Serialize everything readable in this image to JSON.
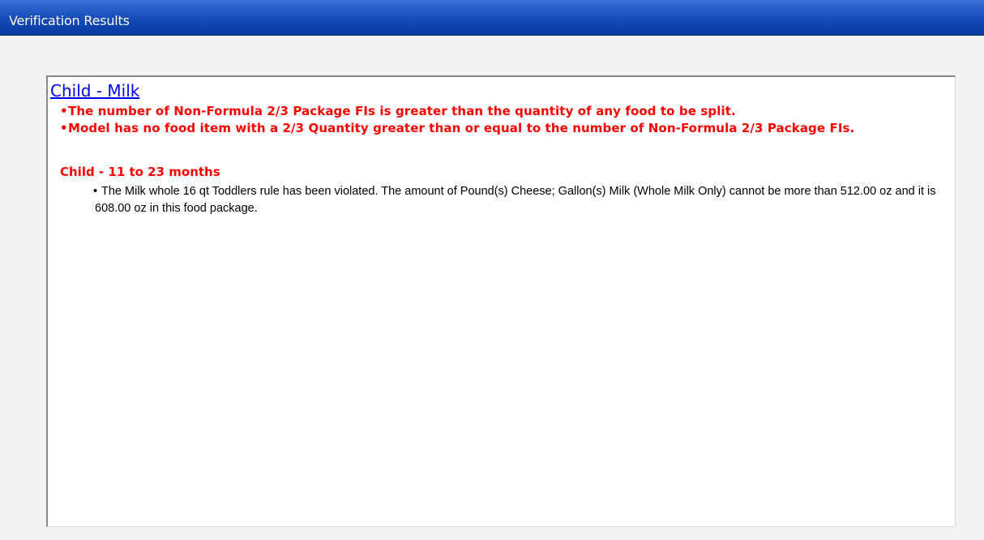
{
  "window": {
    "title": "Verification Results"
  },
  "results": {
    "group_title": "Child - Milk",
    "errors": [
      "The number of Non-Formula 2/3 Package FIs is greater than the quantity of any food to be split.",
      "Model has no food item with a 2/3 Quantity greater than or equal to the number of Non-Formula 2/3 Package FIs."
    ],
    "subgroup": {
      "title": "Child - 11 to 23 months",
      "violations": [
        "The Milk whole 16 qt Toddlers rule has been violated. The amount of Pound(s) Cheese; Gallon(s) Milk (Whole Milk Only) cannot be more than 512.00 oz and it is 608.00 oz in this food package."
      ]
    },
    "bullet_glyph": "•"
  },
  "colors": {
    "title_bar": "#1f56c2",
    "error_text": "#ff0000",
    "link": "#0000ee"
  }
}
